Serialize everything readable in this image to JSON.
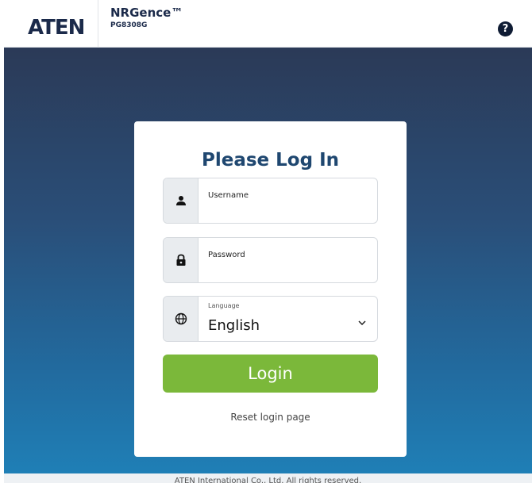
{
  "header": {
    "logo_text": "ATEN",
    "product_name": "NRGence™",
    "product_model": "PG8308G",
    "help_label": "?"
  },
  "login": {
    "title": "Please Log In",
    "username_label": "Username",
    "password_label": "Password",
    "language_label": "Language",
    "language_value": "English",
    "login_button": "Login",
    "reset_link": "Reset login page"
  },
  "footer": {
    "text": "ATEN International Co., Ltd. All rights reserved."
  },
  "colors": {
    "brand_dark": "#1b2a4a",
    "title_blue": "#1f4770",
    "login_green": "#7bb83a"
  },
  "icons": {
    "username": "user-icon",
    "password": "lock-icon",
    "language": "globe-icon",
    "select": "chevron-down-icon",
    "help": "help-icon"
  }
}
